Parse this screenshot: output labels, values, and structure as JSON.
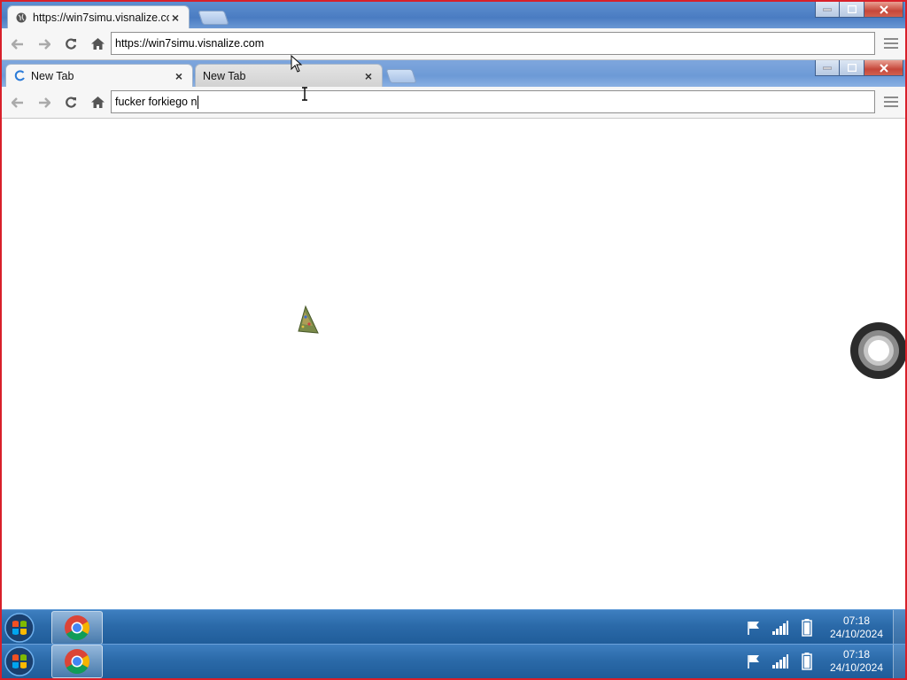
{
  "window1": {
    "tabs": [
      {
        "label": "https://win7simu.visnalize.com",
        "favicon": "globe-icon",
        "active": true
      }
    ],
    "address_value": "https://win7simu.visnalize.com"
  },
  "window2": {
    "tabs": [
      {
        "label": "New Tab",
        "favicon": "loading-spinner-icon",
        "active": true
      },
      {
        "label": "New Tab",
        "favicon": "",
        "active": false
      }
    ],
    "address_value": "fucker forkiego n"
  },
  "taskbar": {
    "clock_time": "07:18",
    "clock_date": "24/10/2024",
    "pinned_app": "chrome-icon",
    "tray_icons": [
      "action-center-flag-icon",
      "network-signal-icon",
      "battery-icon"
    ]
  },
  "colors": {
    "accent_red": "#d8202a",
    "taskbar_blue": "#2b6aa9",
    "chrome_blue": "#4a7cc2"
  }
}
